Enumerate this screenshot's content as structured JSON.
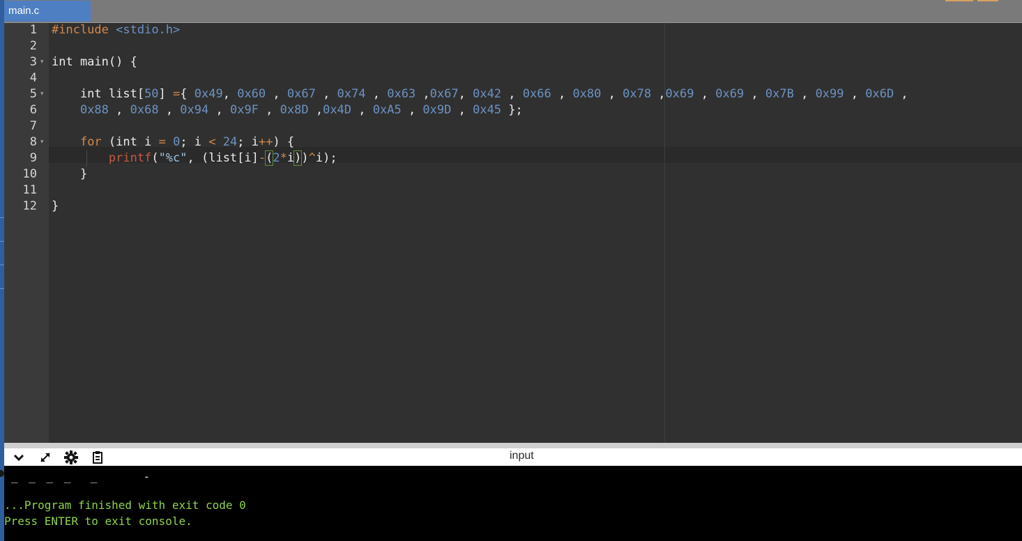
{
  "editor": {
    "tab_label": "main.c",
    "line_numbers": [
      "1",
      "2",
      "3",
      "4",
      "5",
      "6",
      "7",
      "8",
      "9",
      "10",
      "11",
      "12"
    ],
    "fold_markers_on_lines": [
      3,
      5,
      8
    ],
    "lines": [
      [
        [
          "pre",
          "#include"
        ],
        [
          "plain",
          " "
        ],
        [
          "inc",
          "<stdio.h>"
        ]
      ],
      [],
      [
        [
          "plain",
          "int main() {"
        ]
      ],
      [],
      [
        [
          "plain",
          "    int list["
        ],
        [
          "num",
          "50"
        ],
        [
          "plain",
          "] "
        ],
        [
          "op",
          "="
        ],
        [
          "plain",
          "{ "
        ],
        [
          "num",
          "0x49"
        ],
        [
          "plain",
          ", "
        ],
        [
          "num",
          "0x60"
        ],
        [
          "plain",
          " , "
        ],
        [
          "num",
          "0x67"
        ],
        [
          "plain",
          " , "
        ],
        [
          "num",
          "0x74"
        ],
        [
          "plain",
          " , "
        ],
        [
          "num",
          "0x63"
        ],
        [
          "plain",
          " ,"
        ],
        [
          "num",
          "0x67"
        ],
        [
          "plain",
          ", "
        ],
        [
          "num",
          "0x42"
        ],
        [
          "plain",
          " , "
        ],
        [
          "num",
          "0x66"
        ],
        [
          "plain",
          " , "
        ],
        [
          "num",
          "0x80"
        ],
        [
          "plain",
          " , "
        ],
        [
          "num",
          "0x78"
        ],
        [
          "plain",
          " ,"
        ],
        [
          "num",
          "0x69"
        ],
        [
          "plain",
          " , "
        ],
        [
          "num",
          "0x69"
        ],
        [
          "plain",
          " , "
        ],
        [
          "num",
          "0x7B"
        ],
        [
          "plain",
          " , "
        ],
        [
          "num",
          "0x99"
        ],
        [
          "plain",
          " , "
        ],
        [
          "num",
          "0x6D"
        ],
        [
          "plain",
          " ,"
        ]
      ],
      [
        [
          "plain",
          "    "
        ],
        [
          "num",
          "0x88"
        ],
        [
          "plain",
          " , "
        ],
        [
          "num",
          "0x68"
        ],
        [
          "plain",
          " , "
        ],
        [
          "num",
          "0x94"
        ],
        [
          "plain",
          " , "
        ],
        [
          "num",
          "0x9F"
        ],
        [
          "plain",
          " , "
        ],
        [
          "num",
          "0x8D"
        ],
        [
          "plain",
          " ,"
        ],
        [
          "num",
          "0x4D"
        ],
        [
          "plain",
          " , "
        ],
        [
          "num",
          "0xA5"
        ],
        [
          "plain",
          " , "
        ],
        [
          "num",
          "0x9D"
        ],
        [
          "plain",
          " , "
        ],
        [
          "num",
          "0x45"
        ],
        [
          "plain",
          " };"
        ]
      ],
      [],
      [
        [
          "plain",
          "    "
        ],
        [
          "kw",
          "for"
        ],
        [
          "plain",
          " (int i "
        ],
        [
          "op",
          "="
        ],
        [
          "plain",
          " "
        ],
        [
          "num",
          "0"
        ],
        [
          "plain",
          "; i "
        ],
        [
          "op",
          "<"
        ],
        [
          "plain",
          " "
        ],
        [
          "num",
          "24"
        ],
        [
          "plain",
          "; i"
        ],
        [
          "op",
          "++"
        ],
        [
          "plain",
          ") {"
        ]
      ],
      [
        [
          "plain",
          "        "
        ],
        [
          "fn",
          "printf"
        ],
        [
          "plain",
          "("
        ],
        [
          "str",
          "\"%c\""
        ],
        [
          "plain",
          ", (list[i]"
        ],
        [
          "op",
          "-"
        ],
        [
          "br",
          "("
        ],
        [
          "num",
          "2"
        ],
        [
          "op",
          "*"
        ],
        [
          "plain",
          "i"
        ],
        [
          "br",
          ")"
        ],
        [
          "plain",
          ")"
        ],
        [
          "op",
          "^"
        ],
        [
          "plain",
          "i);"
        ]
      ],
      [
        [
          "plain",
          "    }"
        ]
      ],
      [],
      [
        [
          "plain",
          "}"
        ]
      ]
    ]
  },
  "io_panel": {
    "title": "input",
    "buttons": [
      {
        "name": "collapse-button",
        "icon": "chevron-down-icon",
        "glyph": "⌄"
      },
      {
        "name": "expand-button",
        "icon": "expand-arrows-icon",
        "glyph": "⤢"
      },
      {
        "name": "settings-button",
        "icon": "gear-icon",
        "glyph": "⚙"
      },
      {
        "name": "copy-output-button",
        "icon": "clipboard-icon",
        "glyph": "📋"
      }
    ]
  },
  "console": {
    "output": "_ _ _ _  _     -",
    "finished": "...Program finished with exit code 0",
    "press_enter": "Press ENTER to exit console."
  },
  "colors": {
    "editor_bg": "#303030",
    "gutter_bg": "#3a3a3a",
    "tab_active": "#4f7fc3",
    "console_text": "#8fd34a"
  }
}
